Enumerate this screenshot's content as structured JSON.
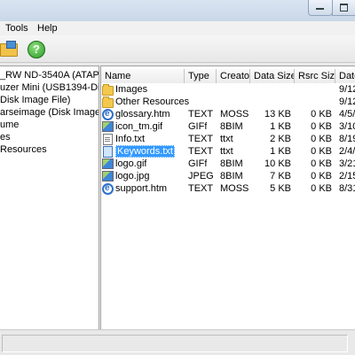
{
  "menu": {
    "items": [
      "Tools",
      "Help"
    ]
  },
  "tree": {
    "items": [
      "_RW ND-3540A (ATAPI-C",
      "uzer Mini (USB1394-Disk)",
      "Disk Image File)",
      "arseimage (Disk Image File)",
      "ume",
      "es",
      "Resources"
    ]
  },
  "files": {
    "columns": [
      "Name",
      "Type",
      "Creator",
      "Data Size",
      "Rsrc Size",
      "Date"
    ],
    "rows": [
      {
        "icon": "folder-icon",
        "name": "Images",
        "type": "",
        "creator": "",
        "data": "",
        "rsrc": "",
        "date": "9/12"
      },
      {
        "icon": "folder-icon",
        "name": "Other Resources",
        "type": "",
        "creator": "",
        "data": "",
        "rsrc": "",
        "date": "9/12"
      },
      {
        "icon": "html-file-icon",
        "name": "glossary.htm",
        "type": "TEXT",
        "creator": "MOSS",
        "data": "13 KB",
        "rsrc": "0 KB",
        "date": "4/5/"
      },
      {
        "icon": "image-file-icon",
        "name": "icon_tm.gif",
        "type": "GIFf",
        "creator": "8BIM",
        "data": "1 KB",
        "rsrc": "0 KB",
        "date": "3/10"
      },
      {
        "icon": "text-file-icon",
        "name": "Info.txt",
        "type": "TEXT",
        "creator": "ttxt",
        "data": "2 KB",
        "rsrc": "0 KB",
        "date": "8/19"
      },
      {
        "icon": "text-file-icon",
        "name": "Keywords.txt",
        "type": "TEXT",
        "creator": "ttxt",
        "data": "1 KB",
        "rsrc": "0 KB",
        "date": "2/4/"
      },
      {
        "icon": "image-file-icon",
        "name": "logo.gif",
        "type": "GIFf",
        "creator": "8BIM",
        "data": "10 KB",
        "rsrc": "0 KB",
        "date": "3/21"
      },
      {
        "icon": "image-file-icon",
        "name": "logo.jpg",
        "type": "JPEG",
        "creator": "8BIM",
        "data": "7 KB",
        "rsrc": "0 KB",
        "date": "2/15"
      },
      {
        "icon": "html-file-icon",
        "name": "support.htm",
        "type": "TEXT",
        "creator": "MOSS",
        "data": "5 KB",
        "rsrc": "0 KB",
        "date": "8/31"
      }
    ]
  },
  "colors": {
    "selection": "#3399ff"
  }
}
